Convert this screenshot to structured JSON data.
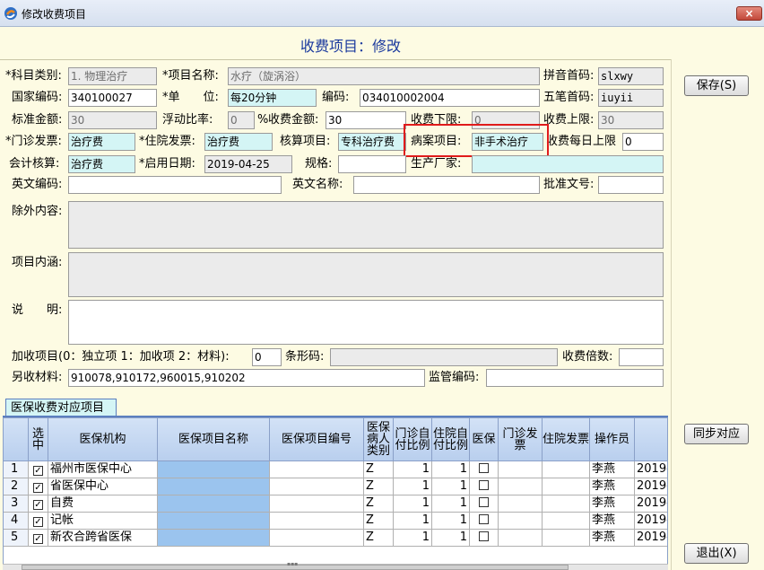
{
  "window": {
    "title": "修改收费项目",
    "close_label": "×"
  },
  "heading": "收费项目：修改",
  "labels": {
    "category": "*科目类别:",
    "item_name": "*项目名称:",
    "pinyin": "拼音首码:",
    "national_code": "国家编码:",
    "unit": "*单　　位:",
    "code": "编码:",
    "wubi": "五笔首码:",
    "std_amount": "标准金额:",
    "float_ratio": "浮动比率:",
    "percent": "%",
    "fee_amount": "收费金额:",
    "fee_lower": "收费下限:",
    "fee_upper": "收费上限:",
    "outpatient_invoice": "*门诊发票:",
    "inpatient_invoice": "*住院发票:",
    "audit_item": "核算项目:",
    "case_item": "病案项目:",
    "daily_limit": "收费每日上限",
    "accounting": "会计核算:",
    "enable_date": "*启用日期:",
    "spec": "规格:",
    "manufacturer": "生产厂家:",
    "english_code": "英文编码:",
    "english_name": "英文名称:",
    "approval_no": "批准文号:",
    "exclusions": "除外内容:",
    "connotation": "项目内涵:",
    "note": "说　　明:",
    "add_item": "加收项目(0：独立项 1：加收项 2：材料):",
    "barcode": "条形码:",
    "fee_multiple": "收费倍数:",
    "extra_material": "另收材料:",
    "supervision_code": "监管编码:"
  },
  "values": {
    "category": "1. 物理治疗",
    "item_name": "水疗（旋涡浴）",
    "pinyin": "slxwy",
    "national_code": "340100027",
    "unit": "每20分钟",
    "code": "034010002004",
    "wubi": "iuyii",
    "std_amount": "30",
    "float_ratio": "0",
    "fee_amount": "30",
    "fee_lower": "0",
    "fee_upper": "30",
    "outpatient_invoice": "治疗费",
    "inpatient_invoice": "治疗费",
    "audit_item": "专科治疗费",
    "case_item": "非手术治疗",
    "daily_limit": "0",
    "accounting": "治疗费",
    "enable_date": "2019-04-25",
    "spec": "",
    "manufacturer": "",
    "english_code": "",
    "english_name": "",
    "approval_no": "",
    "exclusions": "",
    "connotation": "",
    "note": "",
    "add_item": "0",
    "barcode": "",
    "fee_multiple": "",
    "extra_material": "910078,910172,960015,910202",
    "supervision_code": ""
  },
  "buttons": {
    "save": "保存(S)",
    "sync": "同步对应",
    "exit": "退出(X)"
  },
  "grid": {
    "tab_label": "医保收费对应项目",
    "columns": [
      "选中",
      "医保机构",
      "医保项目名称",
      "医保项目编号",
      "医保病人类别",
      "门诊自付比例",
      "住院自付比例",
      "医保",
      "门诊发票",
      "住院发票",
      "操作员",
      ""
    ],
    "rows": [
      {
        "n": "1",
        "org": "福州市医保中心",
        "cat": "Z",
        "op": "1",
        "ip": "1",
        "operator": "李燕",
        "date": "2019-"
      },
      {
        "n": "2",
        "org": "省医保中心",
        "cat": "Z",
        "op": "1",
        "ip": "1",
        "operator": "李燕",
        "date": "2019-"
      },
      {
        "n": "3",
        "org": "自费",
        "cat": "Z",
        "op": "1",
        "ip": "1",
        "operator": "李燕",
        "date": "2019-"
      },
      {
        "n": "4",
        "org": "记帐",
        "cat": "Z",
        "op": "1",
        "ip": "1",
        "operator": "李燕",
        "date": "2019-"
      },
      {
        "n": "5",
        "org": "新农合跨省医保",
        "cat": "Z",
        "op": "1",
        "ip": "1",
        "operator": "李燕",
        "date": "2019-"
      }
    ]
  },
  "colors": {
    "heading": "#1b3a9e",
    "highlight": "#e01b1b",
    "header_bg": "#fdfbe3"
  },
  "icons": {
    "app": "app-logo-icon",
    "check": "✓",
    "scroll_grip": "▪▪▪"
  }
}
